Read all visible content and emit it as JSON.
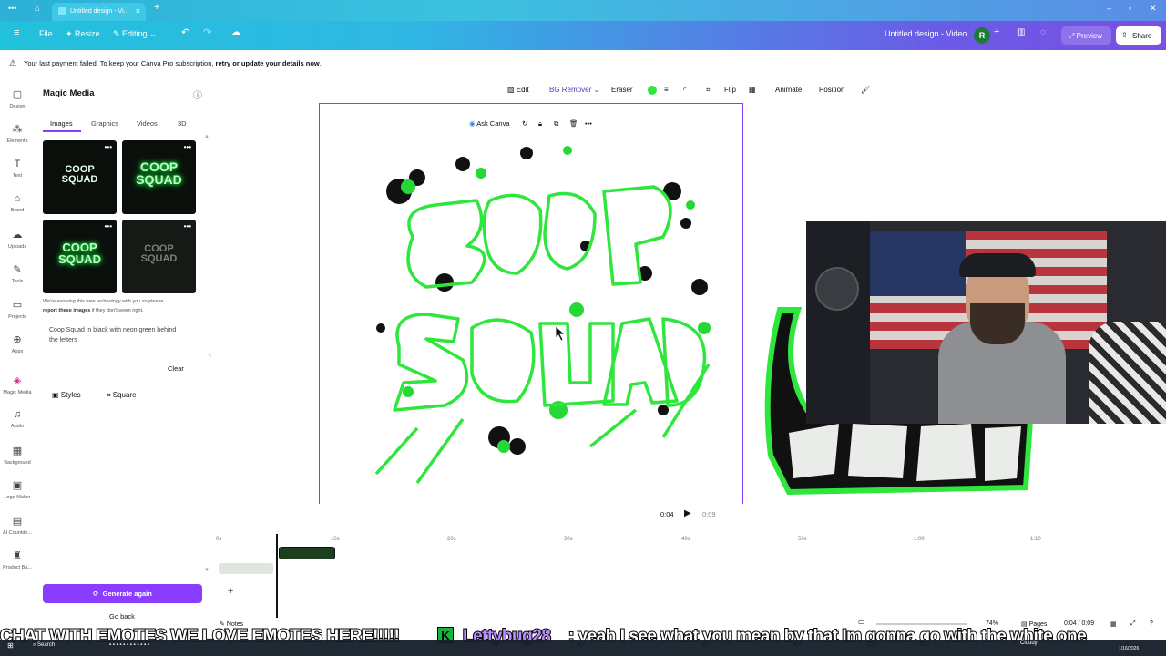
{
  "browser": {
    "tab_title": "Untitled design - Vi...",
    "new_tab": "+"
  },
  "header": {
    "file": "File",
    "resize": "Resize",
    "editing": "Editing",
    "doc_title": "Untitled design - Video",
    "avatar_letter": "R",
    "preview": "Preview",
    "share": "Share"
  },
  "warning": {
    "text": "Your last payment failed. To keep your Canva Pro subscription,",
    "link": "retry or update your details now",
    "end": "."
  },
  "rail": {
    "items": [
      "Design",
      "Elements",
      "Text",
      "Brand",
      "Uploads",
      "Tools",
      "Projects",
      "Apps",
      "Magic Media",
      "Audio",
      "Background",
      "Logo Maker",
      "AI Countdo...",
      "Product Ba..."
    ]
  },
  "panel": {
    "title": "Magic Media",
    "tabs": [
      "Images",
      "Graphics",
      "Videos",
      "3D"
    ],
    "thumbs": [
      {
        "line1": "COOP",
        "line2": "SQUAD"
      },
      {
        "line1": "COOP",
        "line2": "SQUAD"
      },
      {
        "line1": "COOP",
        "line2": "SQUAD"
      },
      {
        "line1": "COOP",
        "line2": "SQUAD"
      }
    ],
    "note_line1": "We're evolving this new technology with you so please",
    "note_link": "report these images",
    "note_line2": "if they don't seem right.",
    "prompt": "Coop Squad in black with neon green behind the letters",
    "clear": "Clear",
    "styles": "Styles",
    "square": "Square",
    "generate": "Generate again",
    "go_back": "Go back"
  },
  "toolbar": {
    "edit": "Edit",
    "bg_remover": "BG Remover",
    "eraser": "Eraser",
    "flip": "Flip",
    "animate": "Animate",
    "position": "Position"
  },
  "canvas": {
    "ask_canva": "Ask Canva",
    "art_line1": "COOP",
    "art_line2": "SQUAD"
  },
  "playback": {
    "current": "0:04",
    "total": "0:09"
  },
  "timeline": {
    "ticks": [
      "0s",
      "10s",
      "20s",
      "30s",
      "40s",
      "50s",
      "1:00",
      "1:10"
    ]
  },
  "bottom": {
    "notes": "Notes",
    "zoom": "74%",
    "pages": "Pages",
    "page_time": "0:04 / 0:09"
  },
  "ticker": {
    "part1": "CHAT WITH EMOTES WE LOVE EMOTES HERE!!!!!",
    "user": "Lettybug28",
    "message": ": yeah I see what you mean by that Im gonna go with the white one"
  },
  "taskbar": {
    "search": "Search",
    "weather": "Cloudy",
    "date": "1/16/2026"
  },
  "colors": {
    "accent": "#8b3dff",
    "neon": "#2fe63d"
  }
}
